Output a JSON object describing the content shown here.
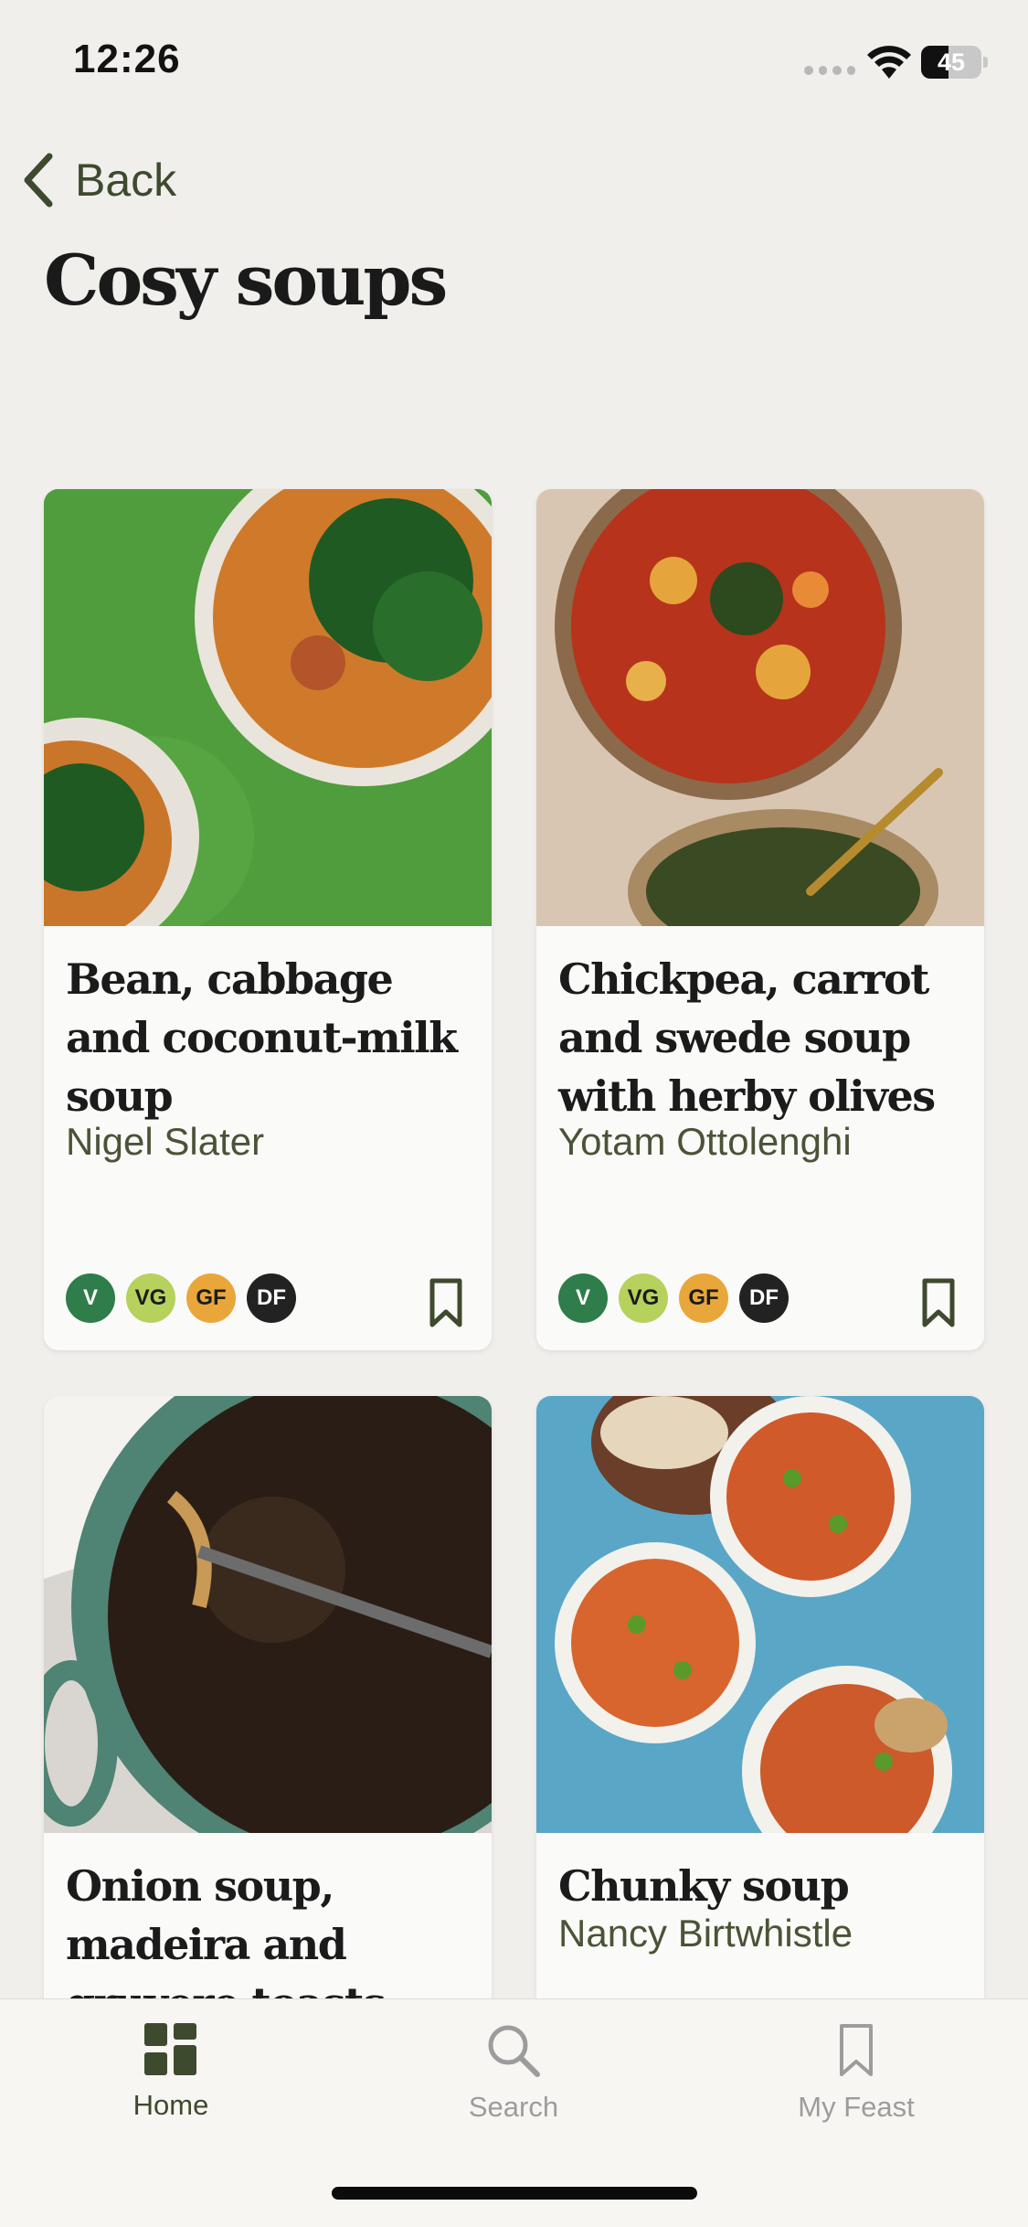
{
  "status_bar": {
    "time": "12:26",
    "battery": "45",
    "battery_level": 0.45
  },
  "header": {
    "back_label": "Back",
    "title": "Cosy soups"
  },
  "cards": [
    {
      "title": "Bean, cabbage and coconut-milk soup",
      "author": "Nigel Slater",
      "badges": [
        "V",
        "VG",
        "GF",
        "DF"
      ]
    },
    {
      "title": "Chickpea, carrot and swede soup with herby olives",
      "author": "Yotam Ottolenghi",
      "badges": [
        "V",
        "VG",
        "GF",
        "DF"
      ]
    },
    {
      "title": "Onion soup, madeira and gruyere toasts",
      "author": ""
    },
    {
      "title": "Chunky soup",
      "author": "Nancy Birtwhistle"
    }
  ],
  "badge_colors": {
    "V": "#2e7d4a",
    "VG": "#b6d15c",
    "GF": "#e9a73b",
    "DF": "#222222"
  },
  "tabbar": {
    "home": "Home",
    "search": "Search",
    "my_feast": "My Feast"
  },
  "colors": {
    "accent": "#3e4a2e",
    "background": "#f1efec"
  }
}
